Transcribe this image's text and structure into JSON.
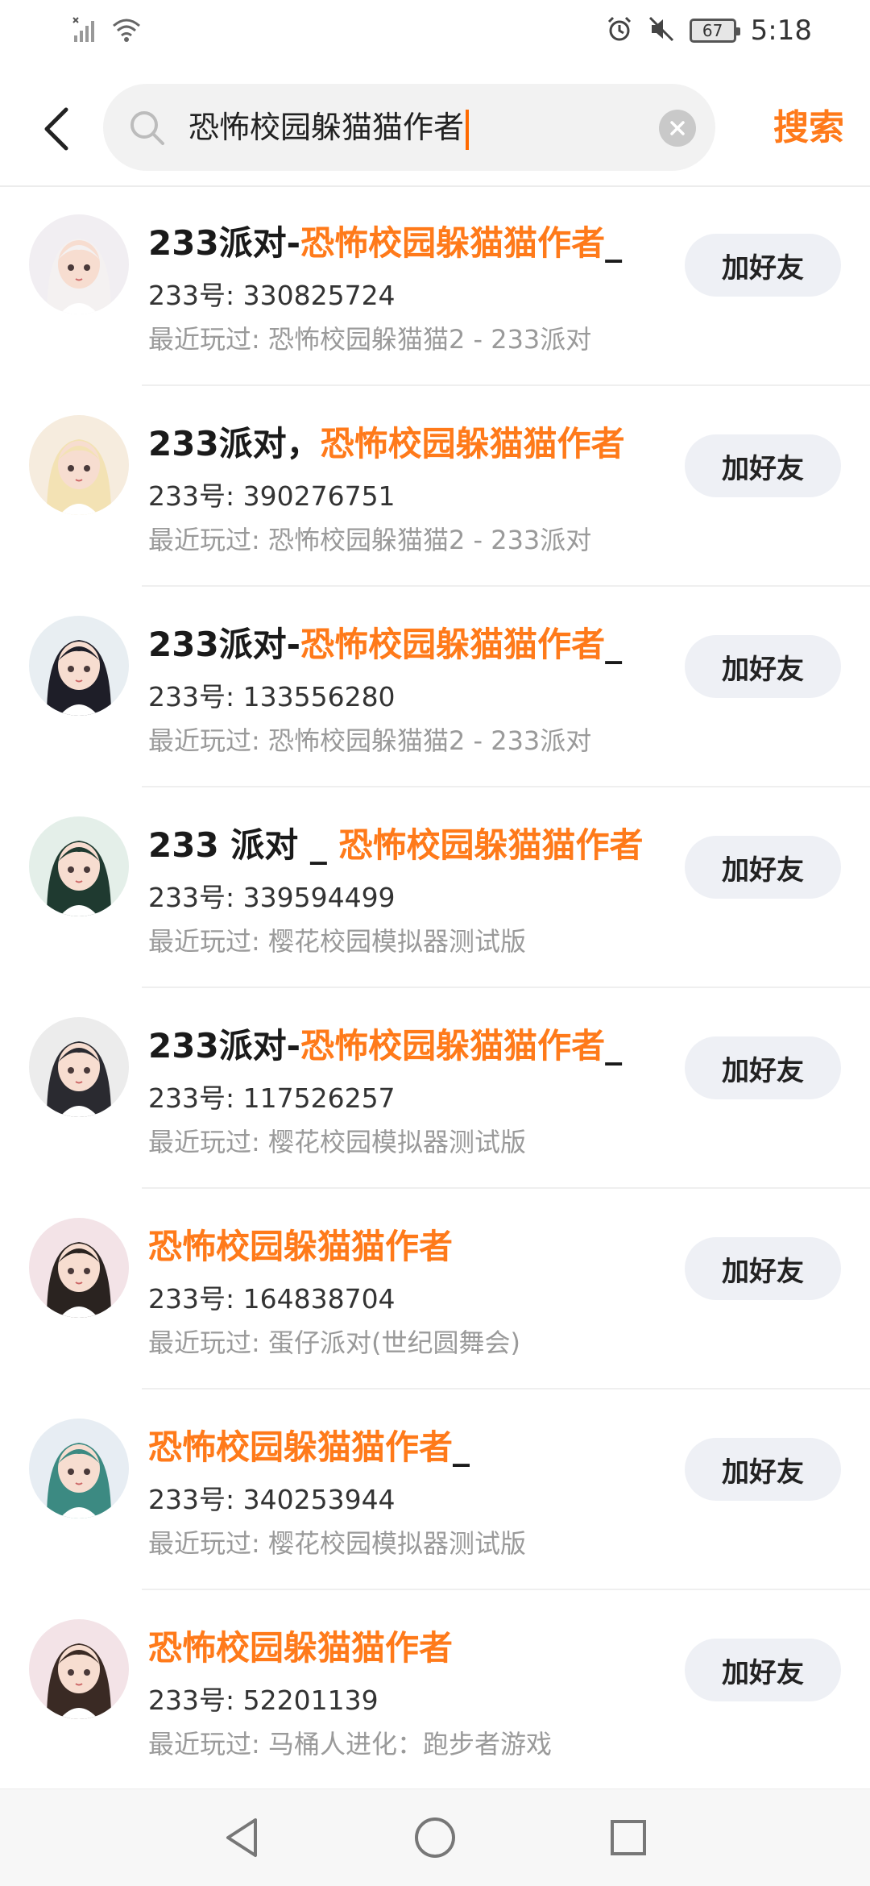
{
  "status_bar": {
    "time": "5:18",
    "battery": "67"
  },
  "search": {
    "query": "恐怖校园躲猫猫作者",
    "submit_label": "搜索"
  },
  "results": [
    {
      "name_prefix": "233派对-",
      "name_highlight": "恐怖校园躲猫猫作者",
      "name_suffix": "_",
      "uid": "233号: 330825724",
      "recent": "最近玩过: 恐怖校园躲猫猫2 - 233派对",
      "button": "加好友"
    },
    {
      "name_prefix": "233派对，",
      "name_highlight": "恐怖校园躲猫猫作者",
      "name_suffix": "",
      "uid": "233号: 390276751",
      "recent": "最近玩过: 恐怖校园躲猫猫2 - 233派对",
      "button": "加好友"
    },
    {
      "name_prefix": "233派对-",
      "name_highlight": "恐怖校园躲猫猫作者",
      "name_suffix": "_",
      "uid": "233号: 133556280",
      "recent": "最近玩过: 恐怖校园躲猫猫2 - 233派对",
      "button": "加好友"
    },
    {
      "name_prefix": "233 派对 _ ",
      "name_highlight": "恐怖校园躲猫猫作者",
      "name_suffix": "",
      "uid": "233号: 339594499",
      "recent": "最近玩过: 樱花校园模拟器测试版",
      "button": "加好友"
    },
    {
      "name_prefix": "233派对-",
      "name_highlight": "恐怖校园躲猫猫作者",
      "name_suffix": "_",
      "uid": "233号: 117526257",
      "recent": "最近玩过: 樱花校园模拟器测试版",
      "button": "加好友"
    },
    {
      "name_prefix": "",
      "name_highlight": "恐怖校园躲猫猫作者",
      "name_suffix": "",
      "uid": "233号: 164838704",
      "recent": "最近玩过: 蛋仔派对(世纪圆舞会)",
      "button": "加好友"
    },
    {
      "name_prefix": "",
      "name_highlight": "恐怖校园躲猫猫作者",
      "name_suffix": "_",
      "uid": "233号: 340253944",
      "recent": "最近玩过: 樱花校园模拟器测试版",
      "button": "加好友"
    },
    {
      "name_prefix": "",
      "name_highlight": "恐怖校园躲猫猫作者",
      "name_suffix": "",
      "uid": "233号: 52201139",
      "recent": "最近玩过: 马桶人进化：跑步者游戏",
      "button": "加好友"
    }
  ],
  "colors": {
    "accent": "#ff7a1a",
    "avatar_palette": [
      "#f1eef2",
      "#f6ecde",
      "#e8eef2",
      "#e4efe9",
      "#ececec",
      "#f3e3e7",
      "#e7edf3",
      "#f3e3e7"
    ],
    "hair_palette": [
      "#f4f1f1",
      "#f3e2b4",
      "#1e1e28",
      "#1f3a30",
      "#2a2a30",
      "#2a2320",
      "#3c8a82",
      "#3a2a24"
    ]
  },
  "icons": {
    "back": "chevron-left-icon",
    "search": "search-icon",
    "clear": "close-circle-icon",
    "nav_back": "triangle-back-icon",
    "nav_home": "circle-home-icon",
    "nav_recent": "square-recent-icon"
  }
}
